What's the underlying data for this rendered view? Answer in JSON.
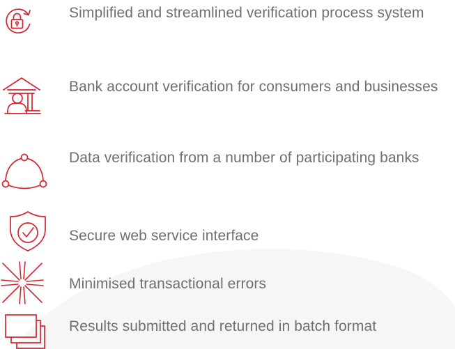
{
  "accent_color": "#d4242f",
  "text_color": "#6f6f6f",
  "features": [
    {
      "icon": "lock-refresh-icon",
      "text": "Simplified and streamlined verification process system"
    },
    {
      "icon": "bank-user-icon",
      "text": "Bank account verification for consumers and businesses"
    },
    {
      "icon": "network-cycle-icon",
      "text": "Data verification from a number of participating banks"
    },
    {
      "icon": "shield-check-icon",
      "text": "Secure web service interface"
    },
    {
      "icon": "starburst-icon",
      "text": "Minimised transactional errors"
    },
    {
      "icon": "stacked-documents-icon",
      "text": "Results submitted and returned in batch format"
    }
  ]
}
